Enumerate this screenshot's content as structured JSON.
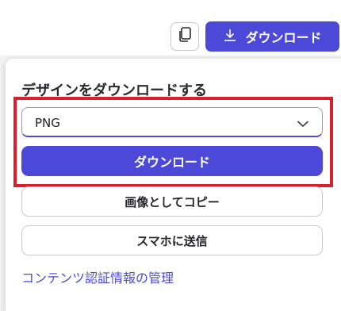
{
  "header": {
    "download_button_label": "ダウンロード"
  },
  "panel": {
    "title": "デザインをダウンロードする",
    "format_select": {
      "value": "PNG"
    },
    "download_button_label": "ダウンロード",
    "copy_image_label": "画像としてコピー",
    "send_to_phone_label": "スマホに送信",
    "content_credentials_link": "コンテンツ認証情報の管理"
  },
  "colors": {
    "accent": "#4d49d8",
    "highlight_border": "#d6202d",
    "text": "#2a2a30"
  },
  "icons": [
    "copy-icon",
    "download-icon",
    "chevron-down-icon"
  ]
}
